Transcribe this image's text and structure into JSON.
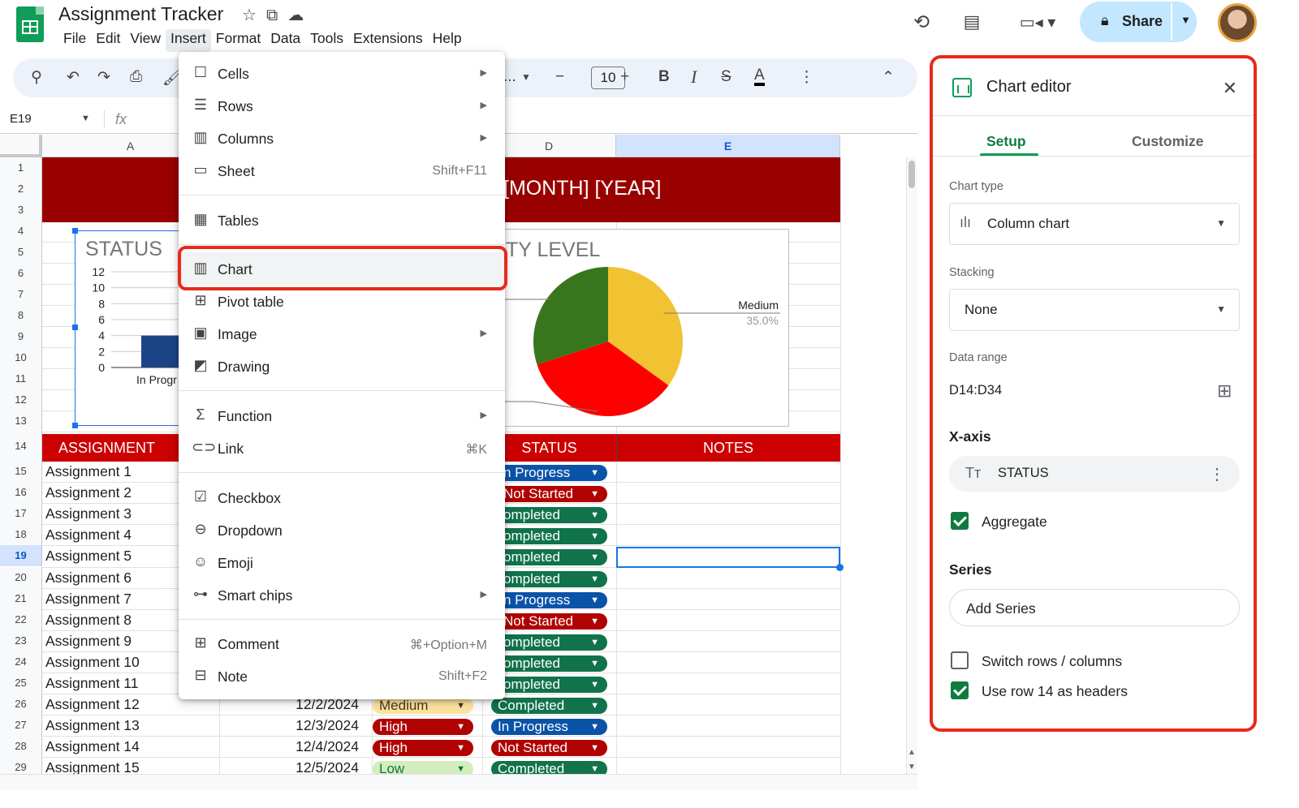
{
  "app": {
    "doc_title": "Assignment Tracker",
    "menus": [
      "File",
      "Edit",
      "View",
      "Insert",
      "Format",
      "Data",
      "Tools",
      "Extensions",
      "Help"
    ],
    "active_menu": "Insert",
    "share_label": "Share"
  },
  "toolbar": {
    "font_size": "10",
    "font_name_trunc": "..."
  },
  "formula_bar": {
    "name_box": "E19",
    "fx": "fx"
  },
  "grid": {
    "columns": [
      "A",
      "D",
      "E"
    ],
    "rows": [
      "1",
      "2",
      "3",
      "4",
      "5",
      "6",
      "7",
      "8",
      "9",
      "10",
      "11",
      "12",
      "13",
      "14",
      "15",
      "16",
      "17",
      "18",
      "19",
      "20",
      "21",
      "22",
      "23",
      "24",
      "25",
      "26",
      "27",
      "28",
      "29"
    ],
    "banner": "[MONTH] [YEAR]",
    "headers": {
      "a": "ASSIGNMENT NA",
      "status": "STATUS",
      "notes": "NOTES"
    },
    "assignments": [
      {
        "name": "Assignment 1",
        "status": "n Progress",
        "type": "prog"
      },
      {
        "name": "Assignment 2",
        "status": "Not Started",
        "type": "not"
      },
      {
        "name": "Assignment 3",
        "status": "ompleted",
        "type": "comp"
      },
      {
        "name": "Assignment 4",
        "status": "ompleted",
        "type": "comp"
      },
      {
        "name": "Assignment 5",
        "status": "ompleted",
        "type": "comp"
      },
      {
        "name": "Assignment 6",
        "status": "ompleted",
        "type": "comp"
      },
      {
        "name": "Assignment 7",
        "status": "n Progress",
        "type": "prog"
      },
      {
        "name": "Assignment 8",
        "status": "Not Started",
        "type": "not"
      },
      {
        "name": "Assignment 9",
        "status": "ompleted",
        "type": "comp"
      },
      {
        "name": "Assignment 10",
        "status": "ompleted",
        "type": "comp"
      },
      {
        "name": "Assignment 11",
        "status": "ompleted",
        "type": "comp"
      },
      {
        "name": "Assignment 12",
        "date": "12/2/2024",
        "priority": "Medium",
        "ptype": "med",
        "status": "Completed",
        "type": "comp"
      },
      {
        "name": "Assignment 13",
        "date": "12/3/2024",
        "priority": "High",
        "ptype": "high",
        "status": "In Progress",
        "type": "prog"
      },
      {
        "name": "Assignment 14",
        "date": "12/4/2024",
        "priority": "High",
        "ptype": "high",
        "status": "Not Started",
        "type": "not"
      },
      {
        "name": "Assignment 15",
        "date": "12/5/2024",
        "priority": "Low",
        "ptype": "low",
        "status": "Completed",
        "type": "comp"
      }
    ]
  },
  "chart_data": [
    {
      "type": "bar",
      "title": "STATUS",
      "categories": [
        "In Progr"
      ],
      "values": [
        4
      ],
      "ylim": [
        0,
        12
      ],
      "yticks": [
        "12",
        "10",
        "8",
        "6",
        "4",
        "2",
        "0"
      ]
    },
    {
      "type": "pie",
      "title": "TY LEVEL",
      "slices": [
        {
          "label": "Medium",
          "value": 35.0,
          "pct_label": "35.0%",
          "color": "#f1c232"
        },
        {
          "label": "",
          "value": 35.0,
          "color": "#ff0000"
        },
        {
          "label": "",
          "value": 30.0,
          "color": "#38761d"
        }
      ]
    }
  ],
  "insert_menu": {
    "items": [
      {
        "label": "Cells",
        "submenu": true
      },
      {
        "label": "Rows",
        "submenu": true
      },
      {
        "label": "Columns",
        "submenu": true
      },
      {
        "label": "Sheet",
        "shortcut": "Shift+F11"
      },
      {
        "label": "Tables"
      },
      {
        "label": "Chart",
        "highlighted": true
      },
      {
        "label": "Pivot table"
      },
      {
        "label": "Image",
        "submenu": true
      },
      {
        "label": "Drawing"
      },
      {
        "label": "Function",
        "submenu": true
      },
      {
        "label": "Link",
        "shortcut": "⌘K"
      },
      {
        "label": "Checkbox"
      },
      {
        "label": "Dropdown"
      },
      {
        "label": "Emoji"
      },
      {
        "label": "Smart chips",
        "submenu": true
      },
      {
        "label": "Comment",
        "shortcut": "⌘+Option+M"
      },
      {
        "label": "Note",
        "shortcut": "Shift+F2"
      }
    ]
  },
  "chart_editor": {
    "title": "Chart editor",
    "tabs": [
      "Setup",
      "Customize"
    ],
    "active_tab": "Setup",
    "chart_type_label": "Chart type",
    "chart_type": "Column chart",
    "stacking_label": "Stacking",
    "stacking": "None",
    "data_range_label": "Data range",
    "data_range": "D14:D34",
    "x_axis_label": "X-axis",
    "x_axis_value": "STATUS",
    "aggregate_label": "Aggregate",
    "aggregate_checked": true,
    "series_label": "Series",
    "add_series": "Add Series",
    "switch_label": "Switch rows / columns",
    "switch_checked": false,
    "headers_label": "Use row 14 as headers",
    "headers_checked": true
  }
}
